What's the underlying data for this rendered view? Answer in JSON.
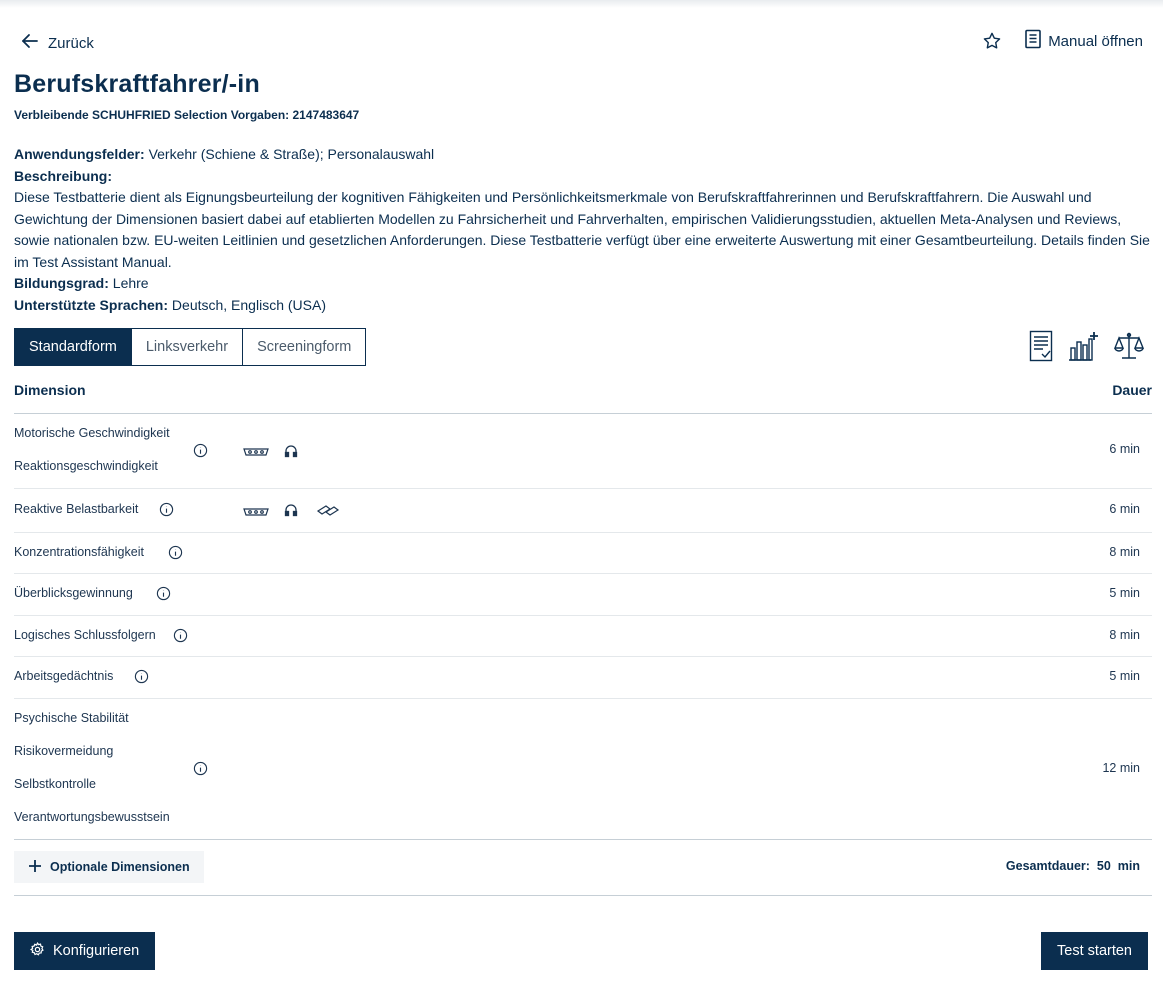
{
  "nav": {
    "back_label": "Zurück",
    "manual_label": "Manual öffnen"
  },
  "header": {
    "title": "Berufskraftfahrer/-in",
    "remaining": "Verbleibende SCHUHFRIED Selection Vorgaben: 2147483647"
  },
  "info": {
    "fields_label": "Anwendungsfelder:",
    "fields_value": "Verkehr (Schiene & Straße); Personalauswahl",
    "description_label": "Beschreibung:",
    "description_text": "Diese Testbatterie dient als Eignungsbeurteilung der kognitiven Fähigkeiten und Persönlichkeitsmerkmale von Berufskraftfahrerinnen und Berufskraftfahrern. Die Auswahl und Gewichtung der Dimensionen basiert dabei auf etablierten Modellen zu Fahrsicherheit und Fahrverhalten, empirischen Validierungsstudien, aktuellen Meta-Analysen und Reviews, sowie nationalen bzw. EU-weiten Leitlinien und gesetzlichen Anforderungen. Diese Testbatterie verfügt über eine erweiterte Auswertung mit einer Gesamtbeurteilung. Details finden Sie im Test Assistant Manual.",
    "education_label": "Bildungsgrad:",
    "education_value": "Lehre",
    "languages_label": "Unterstützte Sprachen:",
    "languages_value": "Deutsch, Englisch (USA)"
  },
  "tabs": [
    {
      "label": "Standardform",
      "active": true
    },
    {
      "label": "Linksverkehr",
      "active": false
    },
    {
      "label": "Screeningform",
      "active": false
    }
  ],
  "tool_icons": [
    "report-icon",
    "chart-add-icon",
    "scale-icon"
  ],
  "table": {
    "col_dimension": "Dimension",
    "col_duration": "Dauer",
    "rows": [
      {
        "dims": [
          "Motorische Geschwindigkeit",
          "Reaktionsgeschwindigkeit"
        ],
        "devices": [
          "panel-icon",
          "headphones-icon"
        ],
        "duration": "6  min"
      },
      {
        "dims": [
          "Reaktive Belastbarkeit"
        ],
        "devices": [
          "panel-icon",
          "headphones-icon",
          "pedals-icon"
        ],
        "duration": "6  min"
      },
      {
        "dims": [
          "Konzentrationsfähigkeit"
        ],
        "devices": [],
        "duration": "8  min"
      },
      {
        "dims": [
          "Überblicksgewinnung"
        ],
        "devices": [],
        "duration": "5  min"
      },
      {
        "dims": [
          "Logisches Schlussfolgern"
        ],
        "devices": [],
        "duration": "8  min"
      },
      {
        "dims": [
          "Arbeitsgedächtnis"
        ],
        "devices": [],
        "duration": "5  min"
      },
      {
        "dims": [
          "Psychische Stabilität",
          "Risikovermeidung",
          "Selbstkontrolle",
          "Verantwortungsbewusstsein"
        ],
        "devices": [],
        "duration": "12  min"
      }
    ]
  },
  "footer": {
    "optional_label": "Optionale Dimensionen",
    "total_label": "Gesamtdauer:",
    "total_value": "50  min",
    "configure_label": "Konfigurieren",
    "start_label": "Test starten"
  },
  "colors": {
    "primary": "#0b2e4f",
    "divider": "#c6cfd6"
  }
}
